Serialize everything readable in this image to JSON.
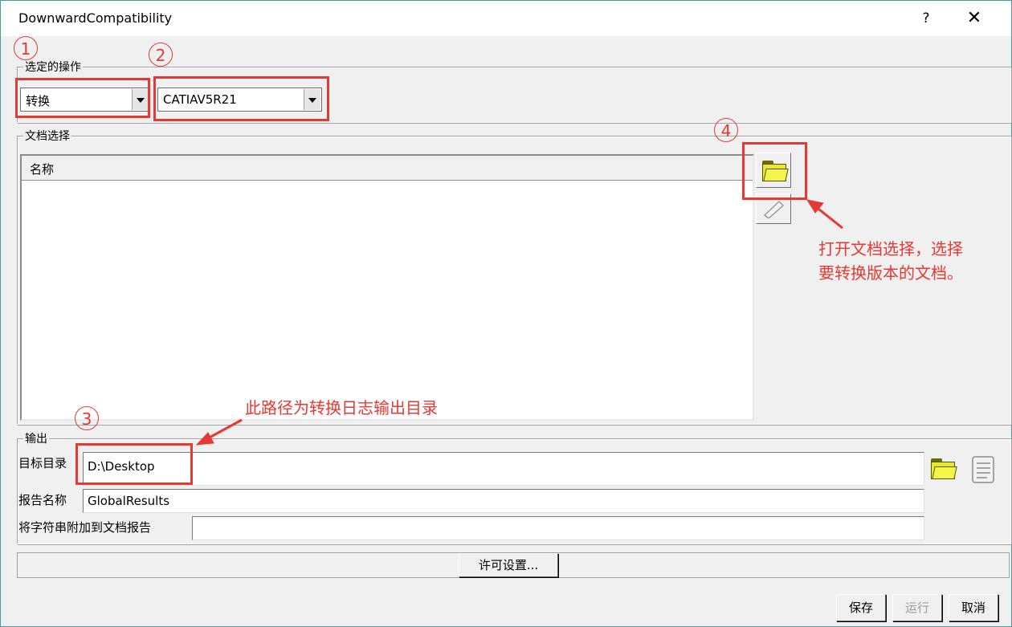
{
  "window": {
    "title": "DownwardCompatibility",
    "help": "?",
    "close": "✕"
  },
  "operation": {
    "legend": "选定的操作",
    "action_value": "转换",
    "version_value": "CATIAV5R21"
  },
  "documents": {
    "legend": "文档选择",
    "column_header": "名称"
  },
  "output": {
    "legend": "输出",
    "target_dir_label": "目标目录",
    "target_dir_value": "D:\\Desktop",
    "report_name_label": "报告名称",
    "report_name_value": "GlobalResults",
    "append_label": "将字符串附加到文档报告",
    "append_value": ""
  },
  "license_button": "许可设置...",
  "buttons": {
    "save": "保存",
    "run": "运行",
    "cancel": "取消"
  },
  "annotations": {
    "n1": "1",
    "n2": "2",
    "n3": "3",
    "n4": "4",
    "note_open_line1": "打开文档选择，选择",
    "note_open_line2": "要转换版本的文档。",
    "note_path": "此路径为转换日志输出目录"
  },
  "colors": {
    "annotation": "#e53935",
    "folder": "#f4f44a"
  }
}
